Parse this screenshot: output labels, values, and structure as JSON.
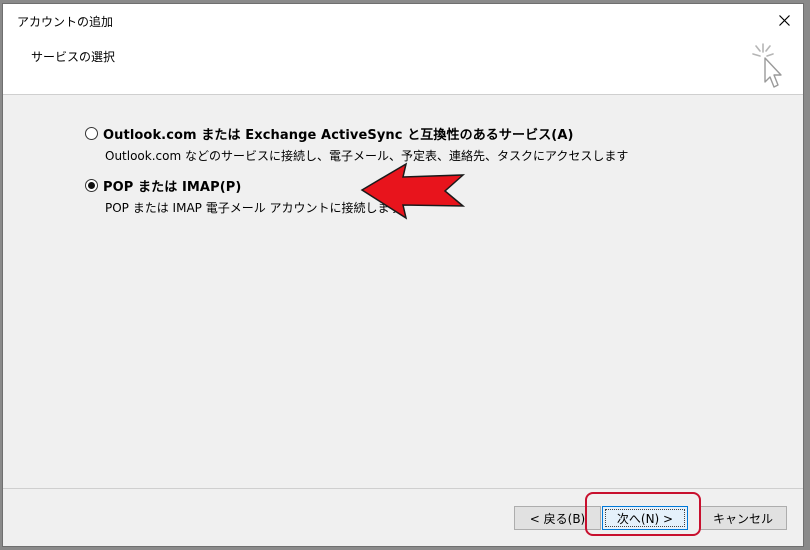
{
  "window": {
    "title": "アカウントの追加",
    "close_icon": "close-icon"
  },
  "header": {
    "title": "サービスの選択",
    "icon": "wizard-cursor-icon"
  },
  "options": [
    {
      "label": "Outlook.com または Exchange ActiveSync と互換性のあるサービス(A)",
      "description": "Outlook.com などのサービスに接続し、電子メール、予定表、連絡先、タスクにアクセスします",
      "selected": false
    },
    {
      "label": "POP または IMAP(P)",
      "description": "POP または IMAP 電子メール アカウントに接続します",
      "selected": true
    }
  ],
  "buttons": {
    "back": "< 戻る(B)",
    "next": "次へ(N) >",
    "cancel": "キャンセル"
  },
  "annotations": {
    "arrow_color": "#e8141c",
    "highlight_color": "#c8102e"
  }
}
